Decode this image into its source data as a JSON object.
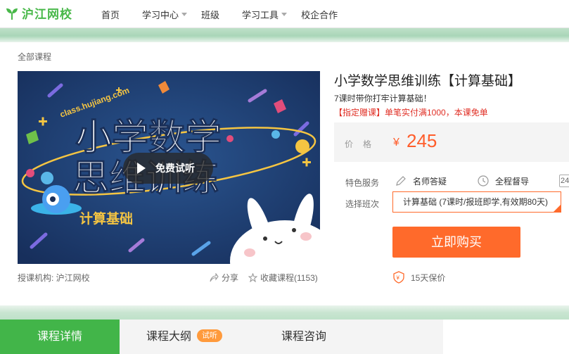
{
  "brand": {
    "name": "沪江网校",
    "color": "#49b84a"
  },
  "nav": {
    "items": [
      {
        "label": "首页",
        "has_dropdown": false
      },
      {
        "label": "学习中心",
        "has_dropdown": true
      },
      {
        "label": "班级",
        "has_dropdown": false
      },
      {
        "label": "学习工具",
        "has_dropdown": true
      },
      {
        "label": "校企合作",
        "has_dropdown": false
      }
    ]
  },
  "breadcrumb": "全部课程",
  "banner": {
    "watermark": "class.hujiang.com",
    "headline_line1": "小学数学",
    "headline_line2": "思维训练",
    "tag": "计算基础",
    "play_label": "免费试听"
  },
  "provider": "授课机构: 沪江网校",
  "share_label": "分享",
  "favorite_label": "收藏课程(1153)",
  "course": {
    "title": "小学数学思维训练【计算基础】",
    "subtitle": "7课时带你打牢计算基础！",
    "promo": "【指定赠课】单笔实付满1000，本课免单",
    "price_label": "价格",
    "currency": "¥",
    "price": "245"
  },
  "services": {
    "label": "特色服务",
    "items": [
      "名师答疑",
      "全程督导"
    ],
    "more": "24"
  },
  "class_select": {
    "label": "选择班次",
    "selected": "计算基础 (7课时/报班即学,有效期80天)"
  },
  "buy_button": "立即购买",
  "guarantee": "15天保价",
  "tabs": [
    {
      "label": "课程详情",
      "active": true
    },
    {
      "label": "课程大纲",
      "badge": "试听"
    },
    {
      "label": "课程咨询"
    }
  ],
  "colors": {
    "accent": "#ff6a2b",
    "price": "#ff5d2b",
    "promo": "#e02e24",
    "tab_active": "#42b549"
  }
}
